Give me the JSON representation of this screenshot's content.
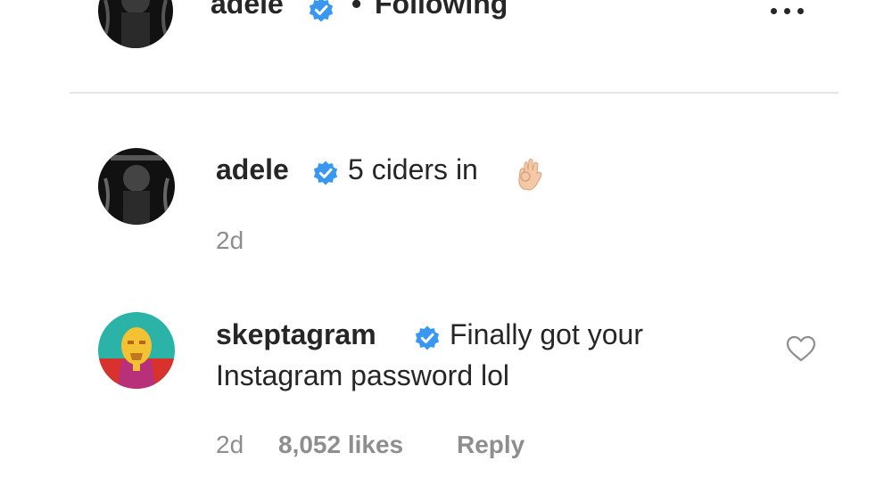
{
  "header": {
    "username": "adele",
    "separator": "•",
    "follow_status": "Following",
    "more_icon": "more-horizontal-icon"
  },
  "comments": [
    {
      "username": "adele",
      "verified": true,
      "text": "5 ciders in",
      "emoji": "ok-hand-emoji",
      "time": "2d"
    },
    {
      "username": "skeptagram",
      "verified": true,
      "text_line1": "Finally got your",
      "text_line2": "Instagram password lol",
      "time": "2d",
      "likes": "8,052 likes",
      "reply_label": "Reply",
      "like_icon": "heart-outline-icon"
    }
  ],
  "colors": {
    "text": "#262626",
    "secondary_text": "#8e8e8e",
    "verified_blue": "#3897f0",
    "divider": "#e6e6e6"
  }
}
